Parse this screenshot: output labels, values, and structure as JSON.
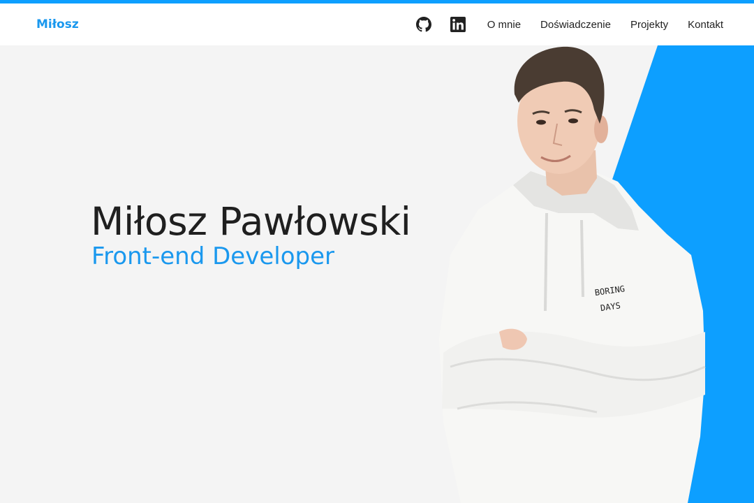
{
  "brand": {
    "name": "Miłosz"
  },
  "nav": {
    "github_icon": "github-icon",
    "linkedin_icon": "linkedin-icon",
    "links": [
      "O mnie",
      "Doświadczenie",
      "Projekty",
      "Kontakt"
    ]
  },
  "hero": {
    "name": "Miłosz Pawłowski",
    "role": "Front-end Developer",
    "hoodie_print": "BORING DAYS"
  },
  "colors": {
    "accent": "#0d9fff",
    "brand_text": "#1a98ee",
    "background": "#f4f4f4",
    "navbar": "#ffffff",
    "text_dark": "#1f1f1f"
  }
}
